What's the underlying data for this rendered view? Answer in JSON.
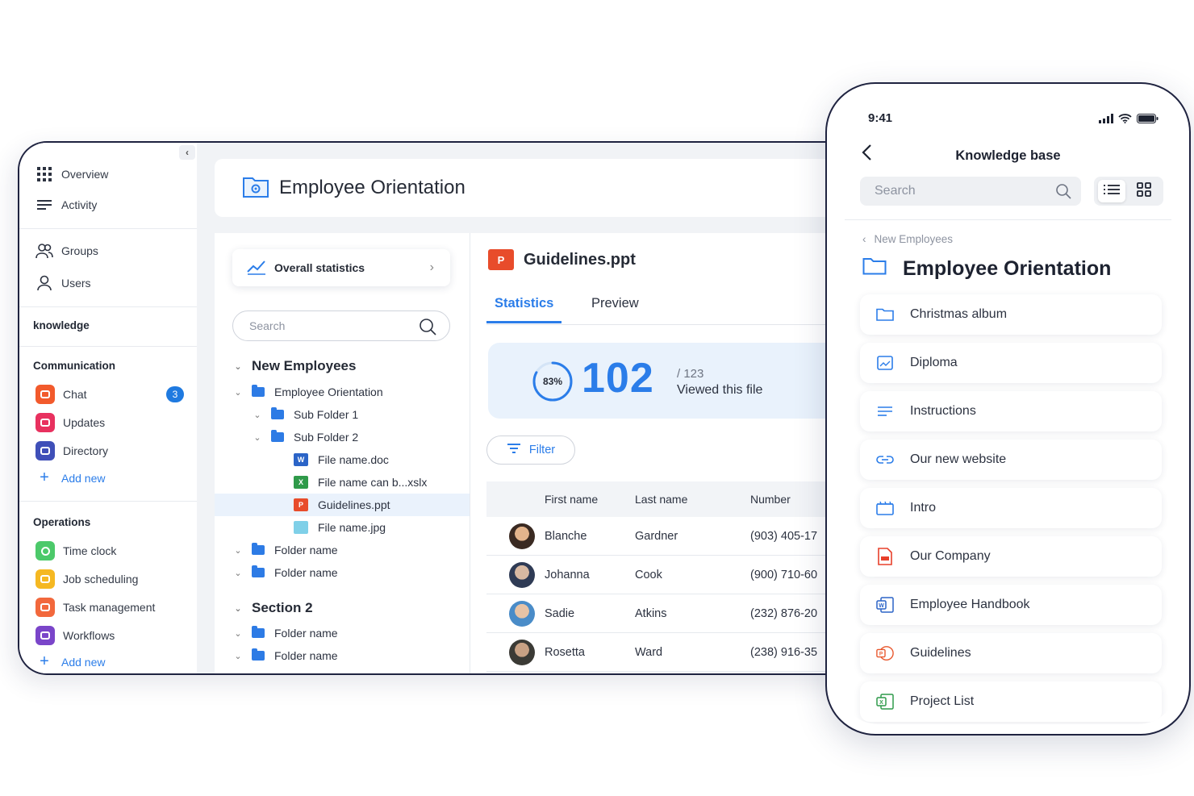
{
  "desktop": {
    "sidebar": {
      "nav": [
        {
          "label": "Overview",
          "icon": "grid-icon"
        },
        {
          "label": "Activity",
          "icon": "activity-lines-icon"
        },
        {
          "label": "Groups",
          "icon": "groups-icon"
        },
        {
          "label": "Users",
          "icon": "user-icon"
        }
      ],
      "knowledge_label": "knowledge",
      "communication": {
        "heading": "Communication",
        "items": [
          {
            "label": "Chat",
            "icon": "chat-icon",
            "color": "#f25a2c",
            "badge": "3"
          },
          {
            "label": "Updates",
            "icon": "updates-icon",
            "color": "#e8315f"
          },
          {
            "label": "Directory",
            "icon": "directory-icon",
            "color": "#3f4fb8"
          }
        ],
        "add_new": "Add new"
      },
      "operations": {
        "heading": "Operations",
        "items": [
          {
            "label": "Time clock",
            "icon": "time-clock-icon",
            "color": "#4cc96a"
          },
          {
            "label": "Job scheduling",
            "icon": "job-scheduling-icon",
            "color": "#f5b822"
          },
          {
            "label": "Task management",
            "icon": "task-management-icon",
            "color": "#f2683c"
          },
          {
            "label": "Workflows",
            "icon": "workflows-icon",
            "color": "#7a45c9"
          }
        ],
        "add_new": "Add new"
      }
    },
    "header": {
      "title": "Employee Orientation"
    },
    "tree": {
      "overall_statistics": "Overall statistics",
      "search_placeholder": "Search",
      "section1": "New Employees",
      "items": {
        "employee_orientation": "Employee Orientation",
        "sub_folder_1": "Sub Folder 1",
        "sub_folder_2": "Sub Folder 2",
        "file_doc": "File name.doc",
        "file_xlsx": "File name can b...xslx",
        "file_ppt": "Guidelines.ppt",
        "file_jpg": "File name.jpg",
        "folder_a": "Folder name",
        "folder_b": "Folder name",
        "folder_c": "Folder name",
        "folder_d": "Folder name"
      },
      "section2": "Section 2"
    },
    "detail": {
      "file_title": "Guidelines.ppt",
      "tabs": [
        "Statistics",
        "Preview"
      ],
      "stats": {
        "percent": "83%",
        "percent_value": 0.83,
        "viewed": "102",
        "total": "/ 123",
        "caption": "Viewed this file"
      },
      "filter_label": "Filter",
      "table": {
        "headers": [
          "First name",
          "Last name",
          "Number"
        ],
        "rows": [
          {
            "first": "Blanche",
            "last": "Gardner",
            "number": "(903) 405-17"
          },
          {
            "first": "Johanna",
            "last": "Cook",
            "number": "(900) 710-60"
          },
          {
            "first": "Sadie",
            "last": "Atkins",
            "number": "(232) 876-20"
          },
          {
            "first": "Rosetta",
            "last": "Ward",
            "number": "(238) 916-35"
          }
        ]
      }
    }
  },
  "phone": {
    "time": "9:41",
    "title": "Knowledge base",
    "search_placeholder": "Search",
    "breadcrumb": "New Employees",
    "heading": "Employee Orientation",
    "items": [
      {
        "label": "Christmas album",
        "icon": "folder-icon"
      },
      {
        "label": "Diploma",
        "icon": "image-icon"
      },
      {
        "label": "Instructions",
        "icon": "text-lines-icon"
      },
      {
        "label": "Our new website",
        "icon": "link-icon"
      },
      {
        "label": "Intro",
        "icon": "video-icon"
      },
      {
        "label": "Our Company",
        "icon": "pdf-icon"
      },
      {
        "label": "Employee Handbook",
        "icon": "word-icon"
      },
      {
        "label": "Guidelines",
        "icon": "powerpoint-icon"
      },
      {
        "label": "Project List",
        "icon": "excel-icon"
      }
    ]
  }
}
